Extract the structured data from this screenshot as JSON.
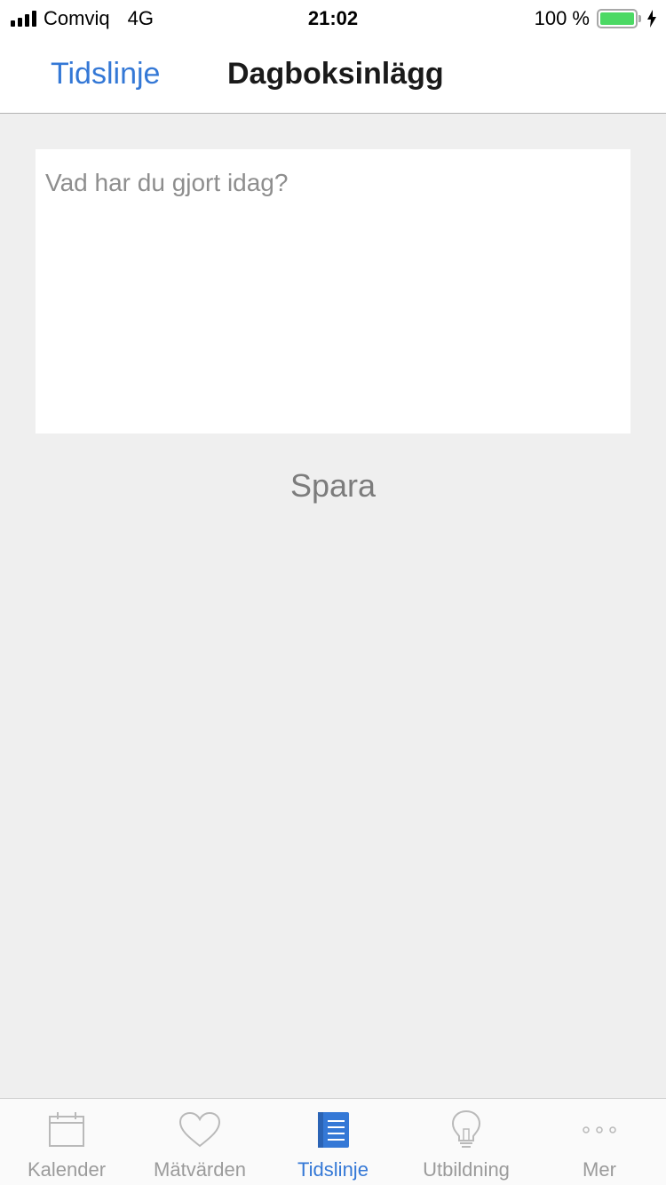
{
  "status_bar": {
    "carrier": "Comviq",
    "network": "4G",
    "time": "21:02",
    "battery_percent": "100 %",
    "battery_level": 1.0,
    "signal_bars": 4,
    "colors": {
      "battery_fill": "#4cd964"
    }
  },
  "nav": {
    "back_label": "Tidslinje",
    "title": "Dagboksinlägg",
    "colors": {
      "accent": "#3478d6"
    }
  },
  "entry": {
    "value": "",
    "placeholder": "Vad har du gjort idag?"
  },
  "actions": {
    "save_label": "Spara"
  },
  "tab_bar": {
    "active_tab": "tidslinje",
    "tabs": [
      {
        "key": "kalender",
        "label": "Kalender",
        "icon": "calendar-icon"
      },
      {
        "key": "matvarden",
        "label": "Mätvärden",
        "icon": "heart-icon"
      },
      {
        "key": "tidslinje",
        "label": "Tidslinje",
        "icon": "journal-icon"
      },
      {
        "key": "utbildning",
        "label": "Utbildning",
        "icon": "lightbulb-icon"
      },
      {
        "key": "mer",
        "label": "Mer",
        "icon": "more-icon"
      }
    ]
  }
}
